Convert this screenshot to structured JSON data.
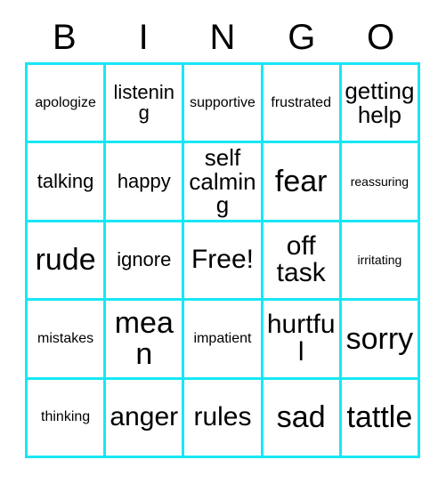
{
  "card": {
    "title_letters": [
      "B",
      "I",
      "N",
      "G",
      "O"
    ],
    "border_color": "#18e7f5",
    "text_color": "#000000",
    "background_color": "#ffffff",
    "rows": 5,
    "columns": 5,
    "cells": [
      [
        {
          "text": "apologize",
          "size": "s"
        },
        {
          "text": "listening",
          "size": "m"
        },
        {
          "text": "supportive",
          "size": "s"
        },
        {
          "text": "frustrated",
          "size": "s"
        },
        {
          "text": "getting help",
          "size": "l"
        }
      ],
      [
        {
          "text": "talking",
          "size": "m"
        },
        {
          "text": "happy",
          "size": "m"
        },
        {
          "text": "self calming",
          "size": "l"
        },
        {
          "text": "fear",
          "size": "xxl"
        },
        {
          "text": "reassuring",
          "size": "xs"
        }
      ],
      [
        {
          "text": "rude",
          "size": "xxl"
        },
        {
          "text": "ignore",
          "size": "m"
        },
        {
          "text": "Free!",
          "size": "xl"
        },
        {
          "text": "off task",
          "size": "xl"
        },
        {
          "text": "irritating",
          "size": "xs"
        }
      ],
      [
        {
          "text": "mistakes",
          "size": "s"
        },
        {
          "text": "mean",
          "size": "xxl"
        },
        {
          "text": "impatient",
          "size": "s"
        },
        {
          "text": "hurtful",
          "size": "xl"
        },
        {
          "text": "sorry",
          "size": "xxl"
        }
      ],
      [
        {
          "text": "thinking",
          "size": "s"
        },
        {
          "text": "anger",
          "size": "xl"
        },
        {
          "text": "rules",
          "size": "xl"
        },
        {
          "text": "sad",
          "size": "xxl"
        },
        {
          "text": "tattle",
          "size": "xxl"
        }
      ]
    ]
  }
}
